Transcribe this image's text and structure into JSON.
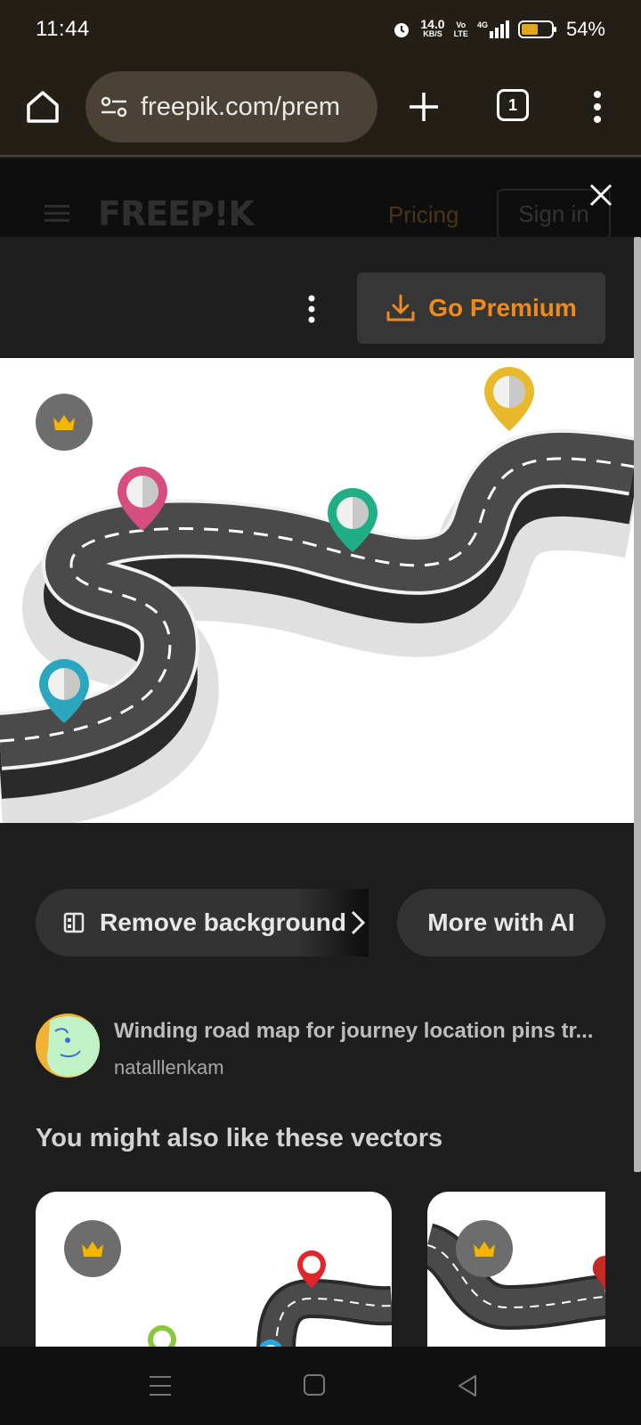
{
  "status_bar": {
    "time": "11:44",
    "net_speed_value": "14.0",
    "net_speed_unit": "KB/S",
    "volte_top": "Vo",
    "volte_bottom": "LTE",
    "network": "4G",
    "battery_percent": "54%"
  },
  "browser": {
    "url": "freepik.com/prem",
    "tab_count": "1"
  },
  "site_header": {
    "logo": "FREEP!K",
    "pricing": "Pricing",
    "sign_in": "Sign in"
  },
  "modal": {
    "go_premium": "Go Premium",
    "remove_background": "Remove background",
    "more_with_ai": "More with AI",
    "asset_title": "Winding road map for journey location pins tr...",
    "author": "natalllenkam",
    "related_heading": "You might also like these vectors"
  },
  "colors": {
    "accent": "#ef8a1c",
    "crown": "#f5b400",
    "pin_pink": "#d64d7f",
    "pin_green": "#1fae85",
    "pin_yellow": "#e8b92c",
    "pin_blue": "#2aa7bf"
  }
}
